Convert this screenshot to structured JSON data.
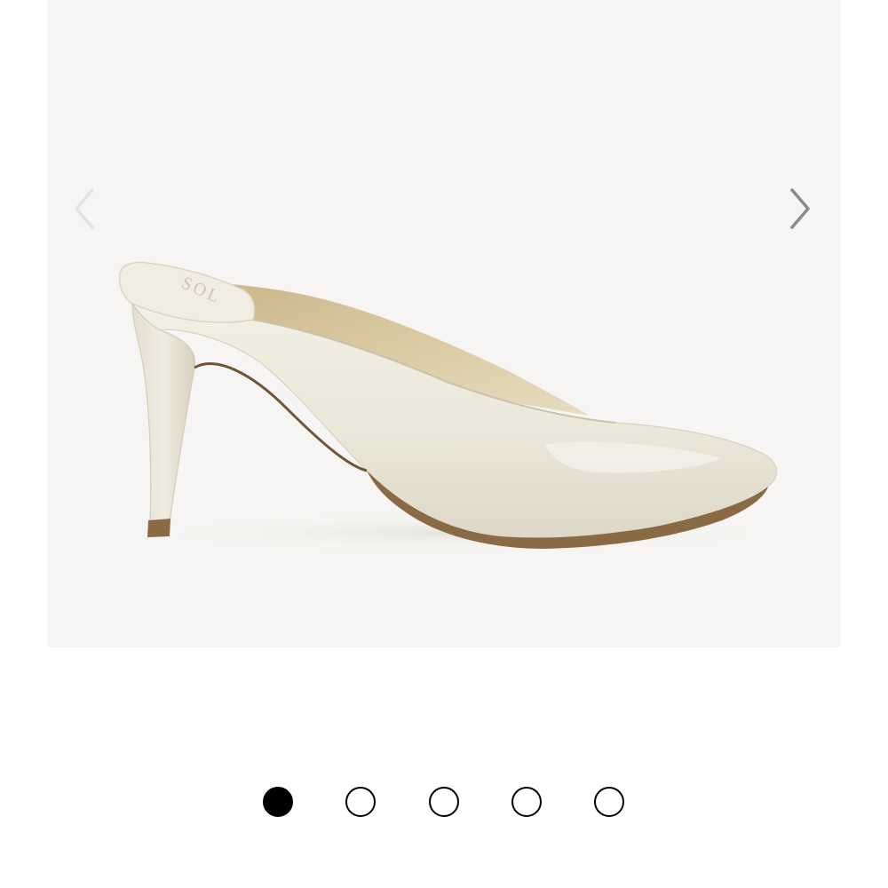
{
  "carousel": {
    "image": {
      "subject": "white-pointed-toe-stiletto-mule",
      "alt": "",
      "brand_mark": "SOL"
    },
    "prev_icon": "chevron-left-icon",
    "next_icon": "chevron-right-icon",
    "colors": {
      "background": "#f6f5f3",
      "shoe": "#ebe7da",
      "lining": "#d9c9a0",
      "sole": "#8a6a44",
      "prev_arrow": "#e3e3e3",
      "next_arrow": "#8a8a8a"
    },
    "pagination": {
      "total": 5,
      "current": 1,
      "active_color": "#000000",
      "inactive_color": "#ffffff"
    }
  }
}
